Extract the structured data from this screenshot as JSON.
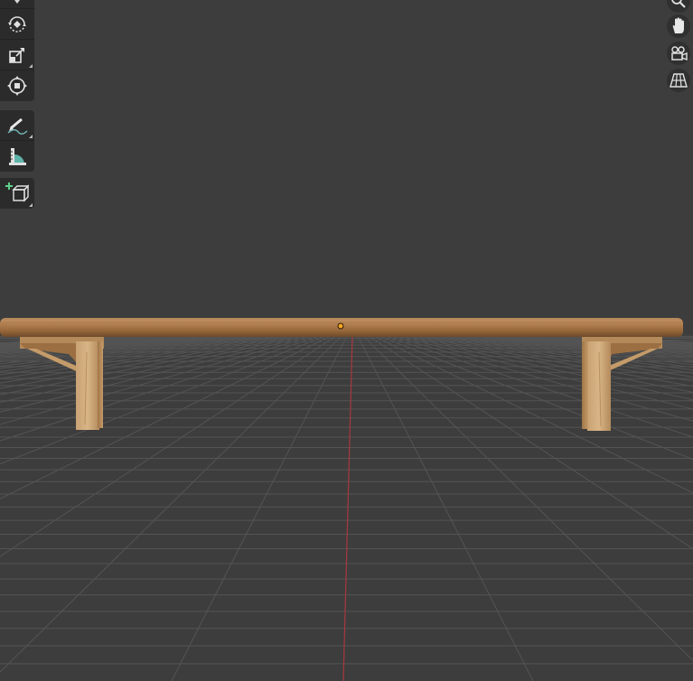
{
  "viewport": {
    "background": "#3d3d3d",
    "grid_color": "#545454",
    "x_axis_color": "#a8383f",
    "origin_color": "#f5a623"
  },
  "toolbar": {
    "tools": [
      {
        "name": "dropdown-arrow-icon"
      },
      {
        "name": "rotate-icon"
      },
      {
        "name": "scale-icon"
      },
      {
        "name": "transform-icon"
      },
      {
        "name": "annotate-icon"
      },
      {
        "name": "measure-icon"
      },
      {
        "name": "add-cube-icon"
      }
    ]
  },
  "navigation": {
    "buttons": [
      {
        "name": "zoom-icon"
      },
      {
        "name": "pan-hand-icon"
      },
      {
        "name": "camera-view-icon"
      },
      {
        "name": "orthographic-grid-icon"
      }
    ]
  },
  "model": {
    "object": "bench",
    "wood_color": "#a9794c"
  }
}
